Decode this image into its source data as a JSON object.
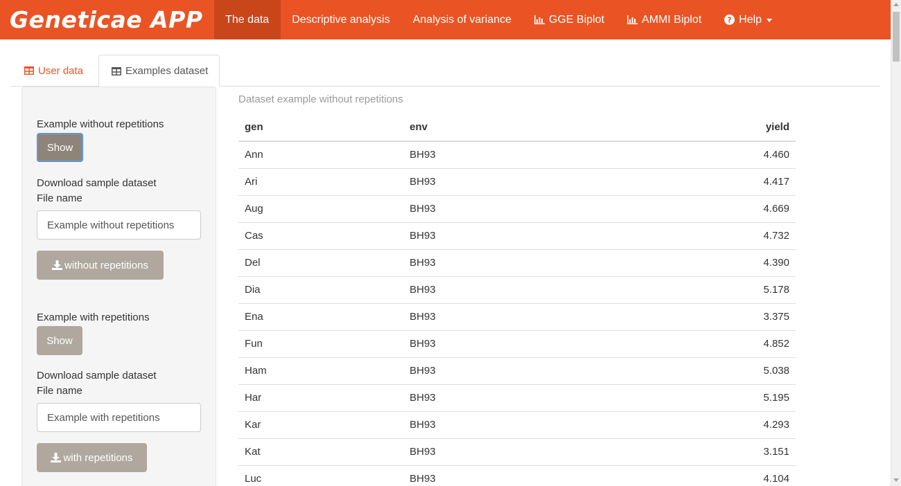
{
  "navbar": {
    "brand": "Geneticae APP",
    "items": [
      {
        "label": "The data",
        "active": true
      },
      {
        "label": "Descriptive analysis"
      },
      {
        "label": "Analysis of variance"
      },
      {
        "label": "GGE Biplot",
        "icon": "bar-chart-icon"
      },
      {
        "label": "AMMI Biplot",
        "icon": "bar-chart-icon"
      },
      {
        "label": "Help",
        "icon": "question-circle-icon"
      }
    ]
  },
  "tabs": {
    "user_data": "User data",
    "examples": "Examples dataset"
  },
  "sidebar": {
    "no_rep_heading": "Example without repetitions",
    "show_label": "Show",
    "download_heading": "Download sample dataset",
    "file_name_label": "File name",
    "no_rep_filename": "Example without repetitions",
    "no_rep_download": "without repetitions",
    "rep_heading": "Example with repetitions",
    "rep_filename": "Example with repetitions",
    "rep_download": "with repetitions"
  },
  "table": {
    "caption": "Dataset example without repetitions",
    "columns": [
      "gen",
      "env",
      "yield"
    ],
    "rows": [
      [
        "Ann",
        "BH93",
        "4.460"
      ],
      [
        "Ari",
        "BH93",
        "4.417"
      ],
      [
        "Aug",
        "BH93",
        "4.669"
      ],
      [
        "Cas",
        "BH93",
        "4.732"
      ],
      [
        "Del",
        "BH93",
        "4.390"
      ],
      [
        "Dia",
        "BH93",
        "5.178"
      ],
      [
        "Ena",
        "BH93",
        "3.375"
      ],
      [
        "Fun",
        "BH93",
        "4.852"
      ],
      [
        "Ham",
        "BH93",
        "5.038"
      ],
      [
        "Har",
        "BH93",
        "5.195"
      ],
      [
        "Kar",
        "BH93",
        "4.293"
      ],
      [
        "Kat",
        "BH93",
        "3.151"
      ],
      [
        "Luc",
        "BH93",
        "4.104"
      ]
    ]
  },
  "colors": {
    "accent": "#ea5424",
    "accent_active": "#c9461b",
    "button": "#b0a89f",
    "button_active": "#8e8479"
  }
}
